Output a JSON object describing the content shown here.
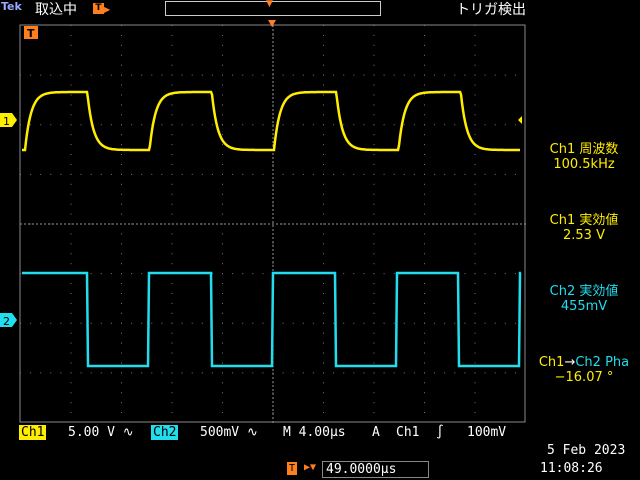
{
  "header": {
    "brand": "Tek",
    "status": "取込中",
    "trigger_status": "トリガ検出"
  },
  "channels": {
    "ch1": {
      "label": "Ch1",
      "marker": "1",
      "scale": "5.00 V",
      "coupling_symbol": "∿",
      "color": "#ffee00"
    },
    "ch2": {
      "label": "Ch2",
      "marker": "2",
      "scale": "500mV",
      "coupling_symbol": "∿",
      "color": "#22ddee"
    }
  },
  "timebase": {
    "scale": "M 4.00µs",
    "delay": "49.0000µs"
  },
  "trigger": {
    "mode": "A",
    "source": "Ch1",
    "slope_symbol": "∫",
    "level": "100mV",
    "marker": "T"
  },
  "measurements": [
    {
      "label": "Ch1 周波数",
      "value": "100.5kHz"
    },
    {
      "label": "Ch1 実効値",
      "value": "2.53 V"
    },
    {
      "label": "Ch2 実効値",
      "value": "455mV"
    },
    {
      "label": "Ch1→Ch2 Pha",
      "value": "−16.07 °"
    }
  ],
  "datetime": {
    "date": "5 Feb  2023",
    "time": "11:08:26"
  },
  "waveform_data": {
    "ch1": {
      "type": "rc-charge-square",
      "cycles": 4,
      "high_div": 1.7,
      "low_div": 0.35
    },
    "ch2": {
      "type": "square",
      "cycles": 4,
      "high_div": 1.1,
      "low_div": -1.1
    }
  }
}
